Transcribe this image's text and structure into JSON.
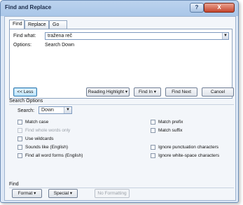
{
  "window": {
    "title": "Find and Replace",
    "help_label": "?",
    "close_label": "X"
  },
  "tabs": [
    {
      "label": "Find",
      "active": true
    },
    {
      "label": "Replace",
      "active": false
    },
    {
      "label": "Go To",
      "active": false
    }
  ],
  "find": {
    "find_what_label": "Find what:",
    "find_what_value": "tražena reč",
    "options_label": "Options:",
    "options_value": "Search Down"
  },
  "buttons": {
    "less": "<< Less",
    "reading_highlight": "Reading Highlight ▾",
    "find_in": "Find In ▾",
    "find_next": "Find Next",
    "cancel": "Cancel"
  },
  "search_options": {
    "section_label": "Search Options",
    "search_label": "Search:",
    "search_value": "Down",
    "checkboxes_left": [
      {
        "label": "Match case",
        "checked": false,
        "disabled": false
      },
      {
        "label": "Find whole words only",
        "checked": false,
        "disabled": true
      },
      {
        "label": "Use wildcards",
        "checked": false,
        "disabled": false
      },
      {
        "label": "Sounds like (English)",
        "checked": false,
        "disabled": false
      },
      {
        "label": "Find all word forms (English)",
        "checked": false,
        "disabled": false
      }
    ],
    "checkboxes_right": [
      {
        "label": "Match prefix",
        "checked": false,
        "disabled": false
      },
      {
        "label": "Match suffix",
        "checked": false,
        "disabled": false
      },
      {
        "label": "Ignore punctuation characters",
        "checked": false,
        "disabled": false
      },
      {
        "label": "Ignore white-space characters",
        "checked": false,
        "disabled": false
      }
    ]
  },
  "find_section": {
    "label": "Find",
    "format_button": "Format ▾",
    "special_button": "Special ▾",
    "no_formatting_button": "No Formatting"
  }
}
